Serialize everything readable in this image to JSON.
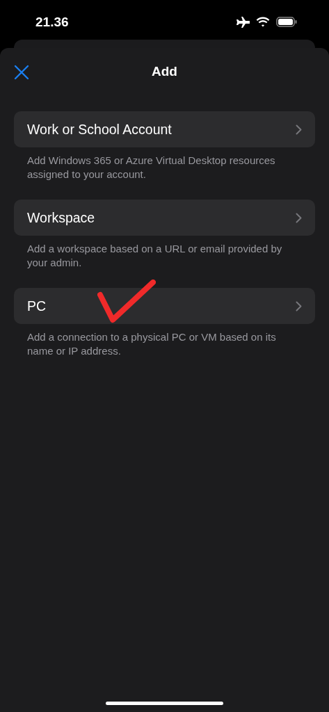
{
  "status_bar": {
    "time": "21.36"
  },
  "header": {
    "title": "Add"
  },
  "options": [
    {
      "label": "Work or School Account",
      "description": "Add Windows 365 or Azure Virtual Desktop resources assigned to your account.",
      "marked": false
    },
    {
      "label": "Workspace",
      "description": "Add a workspace based on a URL or email provided by your admin.",
      "marked": false
    },
    {
      "label": "PC",
      "description": "Add a connection to a physical PC or VM based on its name or IP address.",
      "marked": true
    }
  ]
}
